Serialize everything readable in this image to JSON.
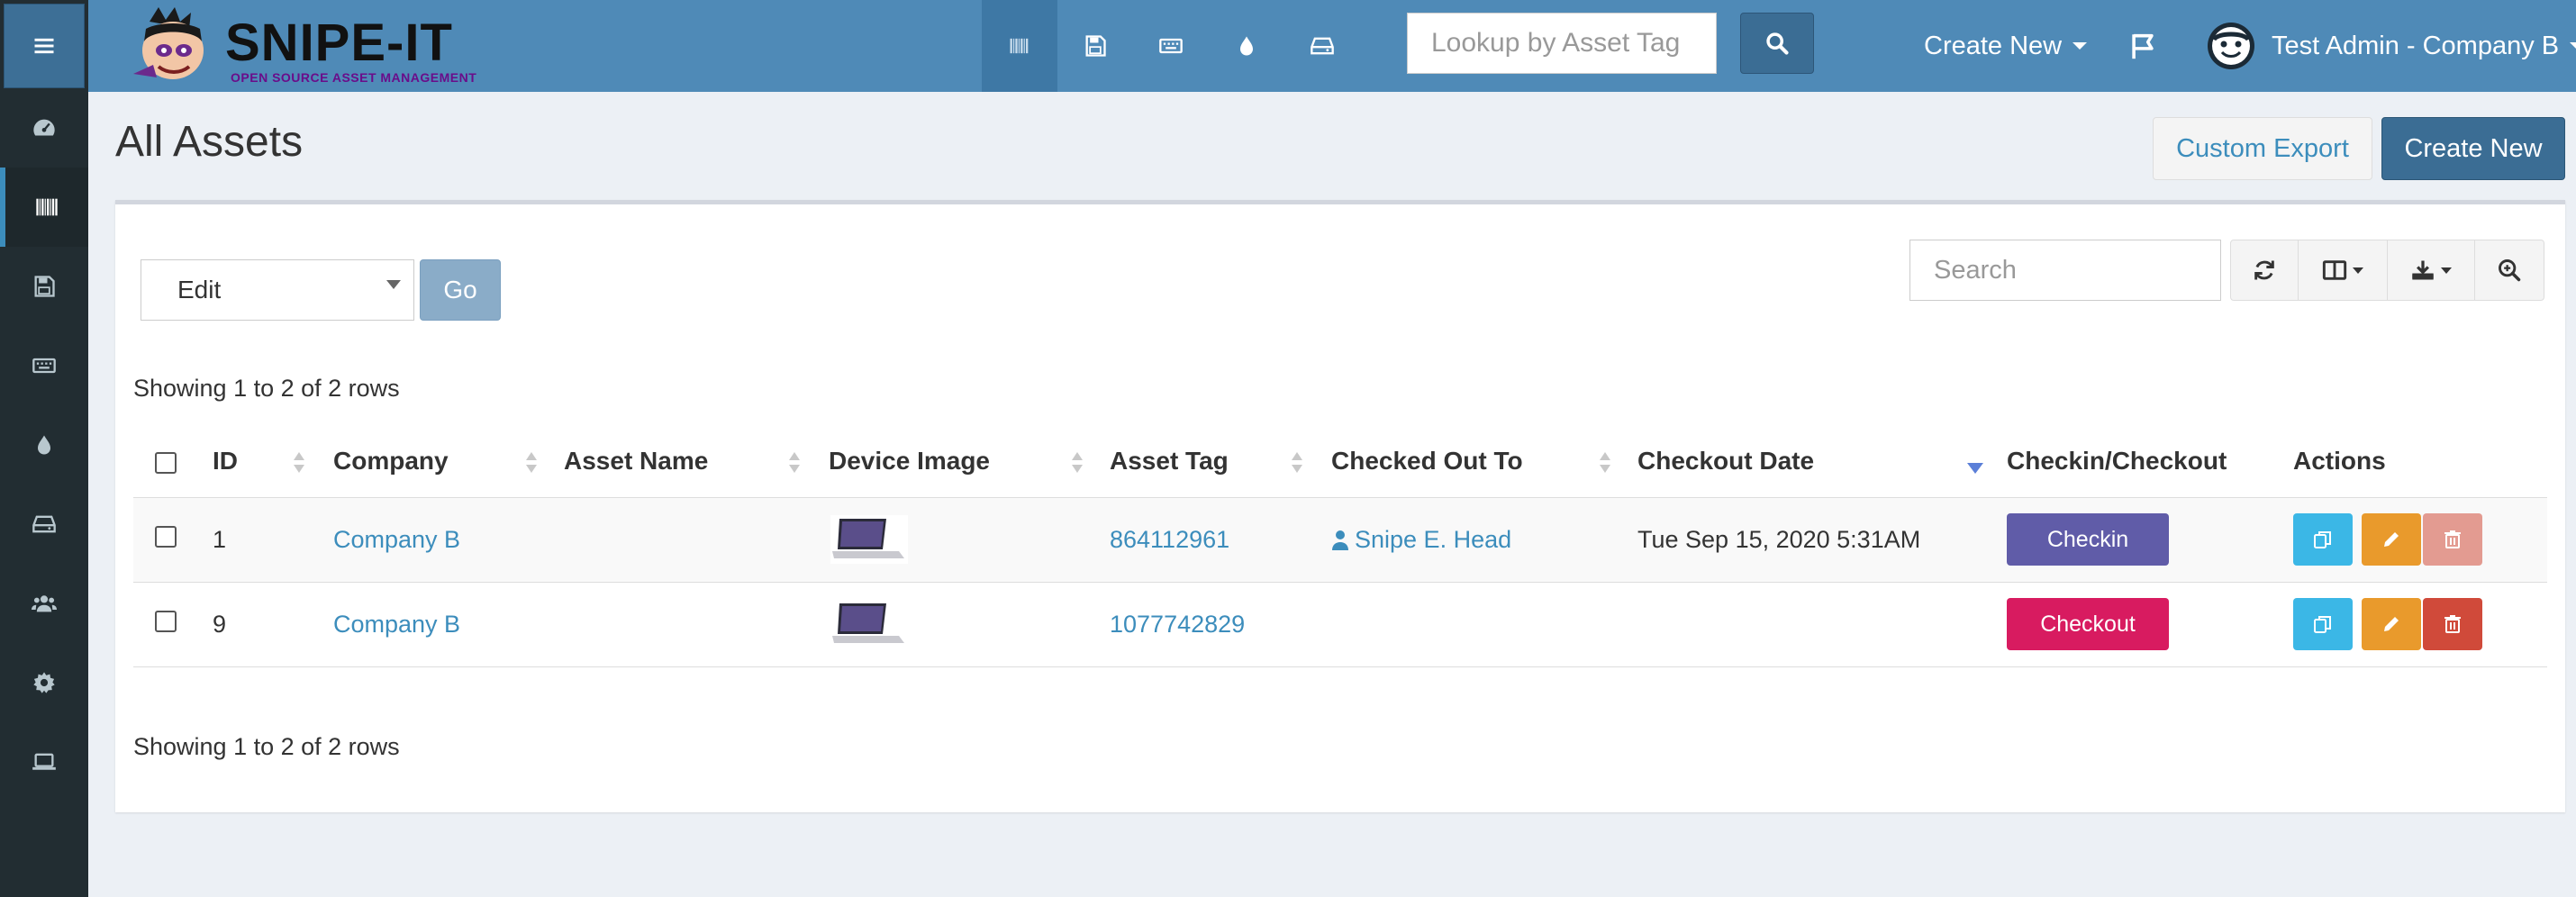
{
  "app": {
    "name": "SNIPE-IT",
    "tagline": "OPEN SOURCE ASSET MANAGEMENT"
  },
  "colors": {
    "header": "#4f8ab7",
    "sidebar": "#222d32",
    "primary": "#3b6d94",
    "link": "#3c8dbc",
    "checkin": "#605ca8",
    "checkout": "#d81b60",
    "clone": "#00c0ef",
    "edit": "#f39c12",
    "delete": "#dd4b39"
  },
  "topbar": {
    "nav_icons": [
      "barcode-icon",
      "save-icon",
      "keyboard-icon",
      "tint-icon",
      "hdd-icon"
    ],
    "lookup_placeholder": "Lookup by Asset Tag",
    "create_new": "Create New",
    "user": "Test Admin - Company B"
  },
  "sidebar": {
    "items": [
      "dashboard-icon",
      "barcode-icon",
      "save-icon",
      "keyboard-icon",
      "tint-icon",
      "hdd-icon",
      "users-icon",
      "cog-icon",
      "laptop-icon"
    ]
  },
  "page": {
    "title": "All Assets",
    "custom_export": "Custom Export",
    "create_new": "Create New"
  },
  "toolbar": {
    "bulk_action": "Edit",
    "go": "Go",
    "search_placeholder": "Search",
    "showing": "Showing 1 to 2 of 2 rows"
  },
  "table": {
    "columns": [
      "ID",
      "Company",
      "Asset Name",
      "Device Image",
      "Asset Tag",
      "Checked Out To",
      "Checkout Date",
      "Checkin/Checkout",
      "Actions"
    ],
    "rows": [
      {
        "id": "1",
        "company": "Company B",
        "asset_name": "",
        "asset_tag": "864112961",
        "checked_out_to": "Snipe E. Head",
        "checkout_date": "Tue Sep 15, 2020 5:31AM",
        "action": "Checkin"
      },
      {
        "id": "9",
        "company": "Company B",
        "asset_name": "",
        "asset_tag": "1077742829",
        "checked_out_to": "",
        "checkout_date": "",
        "action": "Checkout"
      }
    ]
  }
}
